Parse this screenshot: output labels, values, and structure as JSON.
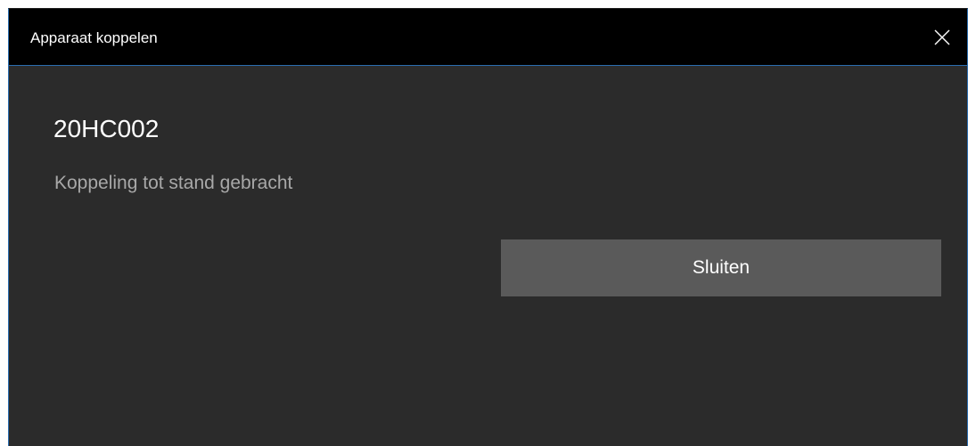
{
  "window": {
    "title": "Apparaat koppelen",
    "close_icon": "close-icon"
  },
  "content": {
    "device_name": "20HC002",
    "status": "Koppeling tot stand gebracht"
  },
  "actions": {
    "close_label": "Sluiten"
  },
  "colors": {
    "titlebar_bg": "#000000",
    "dialog_bg": "#2b2b2b",
    "accent_border": "#2a6db0",
    "button_bg": "#5a5a5a",
    "status_text": "#a8a8a8"
  }
}
